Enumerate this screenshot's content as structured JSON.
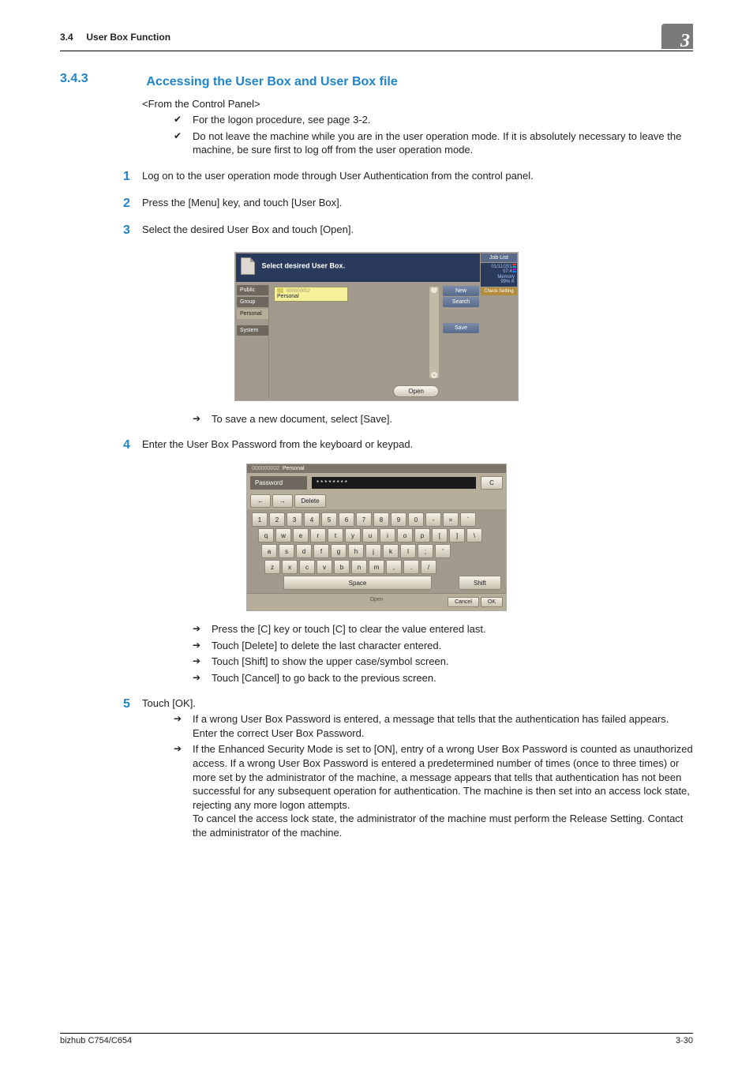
{
  "header": {
    "section_no": "3.4",
    "section_title": "User Box Function",
    "chapter_digit": "3"
  },
  "heading": {
    "number": "3.4.3",
    "title": "Accessing the User Box and User Box file"
  },
  "intro": "<From the Control Panel>",
  "pre_bullets": [
    "For the logon procedure, see page 3-2.",
    "Do not leave the machine while you are in the user operation mode. If it is absolutely necessary to leave the machine, be sure first to log off from the user operation mode."
  ],
  "steps": {
    "s1": {
      "num": "1",
      "text": "Log on to the user operation mode through User Authentication from the control panel."
    },
    "s2": {
      "num": "2",
      "text": "Press the [Menu] key, and touch [User Box]."
    },
    "s3": {
      "num": "3",
      "text": "Select the desired User Box and touch [Open].",
      "arrows": [
        "To save a new document, select [Save]."
      ]
    },
    "s4": {
      "num": "4",
      "text": "Enter the User Box Password from the keyboard or keypad.",
      "arrows": [
        "Press the [C] key or touch [C] to clear the value entered last.",
        "Touch [Delete] to delete the last character entered.",
        "Touch [Shift] to show the upper case/symbol screen.",
        "Touch [Cancel] to go back to the previous screen."
      ]
    },
    "s5": {
      "num": "5",
      "text": "Touch [OK].",
      "arrows": [
        "If a wrong User Box Password is entered, a message that tells that the authentication has failed appears. Enter the correct User Box Password.",
        "If the Enhanced Security Mode is set to [ON], entry of a wrong User Box Password is counted as unauthorized access. If a wrong User Box Password is entered a predetermined number of times (once to three times) or more set by the administrator of the machine, a message appears that tells that authentication has not been successful for any subsequent operation for authentication. The machine is then set into an access lock state, rejecting any more logon attempts."
      ],
      "extra": [
        "To cancel the access lock state, the administrator of the machine must perform the Release Setting. Contact the administrator of the machine."
      ]
    }
  },
  "screenshot1": {
    "message": "Select desired User Box.",
    "joblist": "Job List",
    "timestamp_l1": "01/11/2012",
    "timestamp_l2": "07:41",
    "timestamp_l3": "Memory",
    "timestamp_l4": "99% K",
    "check": "Check Setting",
    "tabs": [
      "Public",
      "Group",
      "Personal",
      "System"
    ],
    "selected_tab_index": 2,
    "box_number": "000000002",
    "box_name": "Personal",
    "side_buttons": [
      "New",
      "Search",
      "Save"
    ],
    "open": "Open"
  },
  "screenshot2": {
    "hdr_num": "000000002",
    "hdr_name": "Personal",
    "pw_label": "Password",
    "pw_value": "********",
    "c": "C",
    "nav": {
      "left": "←",
      "right": "→",
      "delete": "Delete"
    },
    "rows": {
      "r1": [
        "1",
        "2",
        "3",
        "4",
        "5",
        "6",
        "7",
        "8",
        "9",
        "0",
        "-",
        "=",
        "`"
      ],
      "r2": [
        "q",
        "w",
        "e",
        "r",
        "t",
        "y",
        "u",
        "i",
        "o",
        "p",
        "[",
        "]",
        "\\"
      ],
      "r3": [
        "a",
        "s",
        "d",
        "f",
        "g",
        "h",
        "j",
        "k",
        "l",
        ";",
        "'"
      ],
      "r4": [
        "z",
        "x",
        "c",
        "v",
        "b",
        "n",
        "m",
        ",",
        ".",
        "/"
      ]
    },
    "space": "Space",
    "shift": "Shift",
    "open": "Open",
    "cancel": "Cancel",
    "ok": "OK"
  },
  "footer": {
    "left": "bizhub C754/C654",
    "right": "3-30"
  }
}
